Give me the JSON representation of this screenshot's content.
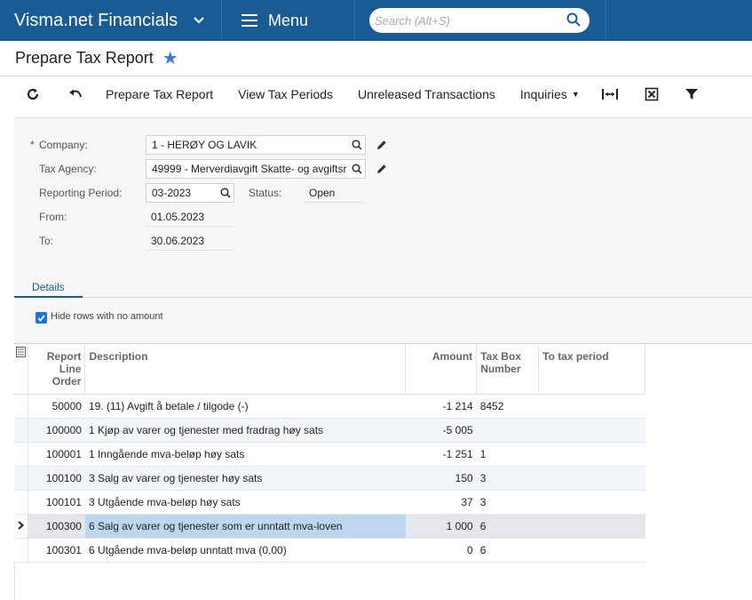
{
  "topbar": {
    "brand": "Visma.net Financials",
    "menu_label": "Menu",
    "search_placeholder": "Search (Alt+S)"
  },
  "page": {
    "title": "Prepare Tax Report"
  },
  "toolbar": {
    "prepare_tax_report": "Prepare Tax Report",
    "view_tax_periods": "View Tax Periods",
    "unreleased_transactions": "Unreleased Transactions",
    "inquiries": "Inquiries"
  },
  "form": {
    "required_mark": "*",
    "company_label": "Company:",
    "company_value": "1 - HERØY OG LAVIK",
    "tax_agency_label": "Tax Agency:",
    "tax_agency_value": "49999 - Merverdiavgift Skatte- og avgiftsr",
    "reporting_period_label": "Reporting Period:",
    "reporting_period_value": "03-2023",
    "status_label": "Status:",
    "status_value": "Open",
    "from_label": "From:",
    "from_value": "01.05.2023",
    "to_label": "To:",
    "to_value": "30.06.2023"
  },
  "tabs": {
    "details": "Details"
  },
  "filter": {
    "hide_rows_label": "Hide rows with no amount",
    "hide_rows_checked": true
  },
  "grid": {
    "headers": {
      "order": "Report Line Order",
      "description": "Description",
      "amount": "Amount",
      "tax_box": "Tax Box Number",
      "to_tax_period": "To tax period"
    },
    "rows": [
      {
        "order": "50000",
        "description": "19. (11) Avgift å betale / tilgode (-)",
        "amount": "-1 214",
        "box": "8452",
        "period": ""
      },
      {
        "order": "100000",
        "description": "1 Kjøp av varer og tjenester med fradrag høy sats",
        "amount": "-5 005",
        "box": "",
        "period": ""
      },
      {
        "order": "100001",
        "description": "1 Inngående mva-beløp høy sats",
        "amount": "-1 251",
        "box": "1",
        "period": ""
      },
      {
        "order": "100100",
        "description": "3 Salg av varer og tjenester høy sats",
        "amount": "150",
        "box": "3",
        "period": ""
      },
      {
        "order": "100101",
        "description": "3 Utgående mva-beløp høy sats",
        "amount": "37",
        "box": "3",
        "period": ""
      },
      {
        "order": "100300",
        "description": "6 Salg av varer og tjenester som er unntatt mva-loven",
        "amount": "1 000",
        "box": "6",
        "period": ""
      },
      {
        "order": "100301",
        "description": "6 Utgående mva-beløp unntatt mva (0,00)",
        "amount": "0",
        "box": "6",
        "period": ""
      }
    ]
  },
  "colors": {
    "topbar": "#1a5b96",
    "accent": "#1a73d6",
    "selected_row": "#bdd7ee"
  }
}
